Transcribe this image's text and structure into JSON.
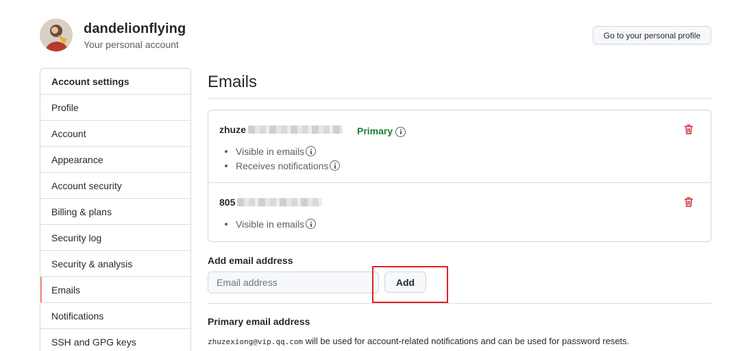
{
  "header": {
    "username": "dandelionflying",
    "subtitle": "Your personal account",
    "profile_button": "Go to your personal profile"
  },
  "sidebar": {
    "heading": "Account settings",
    "items": [
      {
        "label": "Profile"
      },
      {
        "label": "Account"
      },
      {
        "label": "Appearance"
      },
      {
        "label": "Account security"
      },
      {
        "label": "Billing & plans"
      },
      {
        "label": "Security log"
      },
      {
        "label": "Security & analysis"
      },
      {
        "label": "Emails",
        "selected": true
      },
      {
        "label": "Notifications"
      },
      {
        "label": "SSH and GPG keys"
      }
    ]
  },
  "main": {
    "title": "Emails",
    "emails": [
      {
        "address_visible": "zhuze",
        "badge": "Primary",
        "bullets": [
          "Visible in emails",
          "Receives notifications"
        ]
      },
      {
        "address_visible": "805",
        "bullets": [
          "Visible in emails"
        ]
      }
    ],
    "add_section": {
      "label": "Add email address",
      "placeholder": "Email address",
      "button": "Add"
    },
    "primary_section": {
      "heading": "Primary email address",
      "email": "zhuzexiong@vip.qq.com",
      "description": " will be used for account-related notifications and can be used for password resets."
    }
  },
  "colors": {
    "accent_selected": "#fd8c73",
    "primary_green": "#1a7f37",
    "danger_red": "#cf222e",
    "highlight_annotation": "#e02020"
  },
  "icons": {
    "info": "info-icon",
    "trash": "trash-icon"
  }
}
